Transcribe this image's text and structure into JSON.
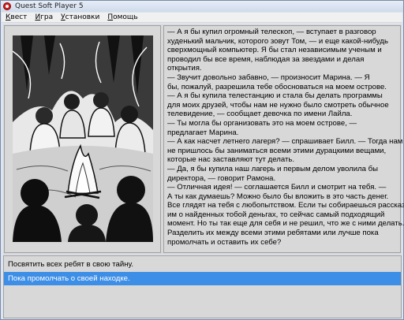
{
  "window": {
    "title": "Quest Soft Player 5"
  },
  "menu": {
    "items": [
      "Квест",
      "Игра",
      "Установки",
      "Помощь"
    ]
  },
  "illustration": {
    "description": "pen-and-ink drawing of children sitting around a campfire in the woods",
    "icon": "campfire-illustration"
  },
  "story": {
    "lines": [
      "— А я бы купил огромный телескоп, — вступает в разговор",
      "худенький мальчик, которого зовут Том, — и еще какой-нибудь",
      "сверхмощный компьютер. Я бы стал независимым ученым и",
      "проводил бы все время, наблюдая за звездами и делая",
      "открытия.",
      "— Звучит довольно забавно, — произносит Марина. — Я",
      "бы, пожалуй, разрешила тебе обосноваться на моем острове.",
      "— А я бы купила телестанцию и стала бы делать программы",
      "для моих друзей, чтобы нам не нужно было смотреть обычное",
      "телевидение, — сообщает девочка по имени Лайла.",
      "— Ты могла бы организовать это на моем острове, —",
      "предлагает Марина.",
      "— А как насчет летнего лагеря? — спрашивает Билл. — Тогда нам",
      "не пришлось бы заниматься всеми этими дурацкими вещами,",
      "которые нас заставляют тут делать.",
      "— Да, я бы купила наш лагерь и первым делом уволила бы",
      "директора, — говорит Рамона.",
      "— Отличная идея! — соглашается Билл и смотрит на тебя. —",
      "А ты как думаешь? Можно было бы вложить в это часть денег.",
      "Все глядят на тебя с любопытством. Если ты собираешься рассказать",
      "им о найденных тобой деньгах, то сейчас самый подходящий",
      "момент. Но ты так еще для себя и не решил, что же с ними делать.",
      "Разделить их между всеми этими ребятами или лучше пока",
      "промолчать и оставить их себе?"
    ]
  },
  "choices": [
    {
      "label": "Посвятить всех ребят в свою тайну.",
      "selected": false
    },
    {
      "label": "Пока промолчать о своей находке.",
      "selected": true
    }
  ],
  "colors": {
    "selection": "#3d8ee6",
    "panel": "#d8d8d8",
    "app_icon": "#d02020"
  }
}
